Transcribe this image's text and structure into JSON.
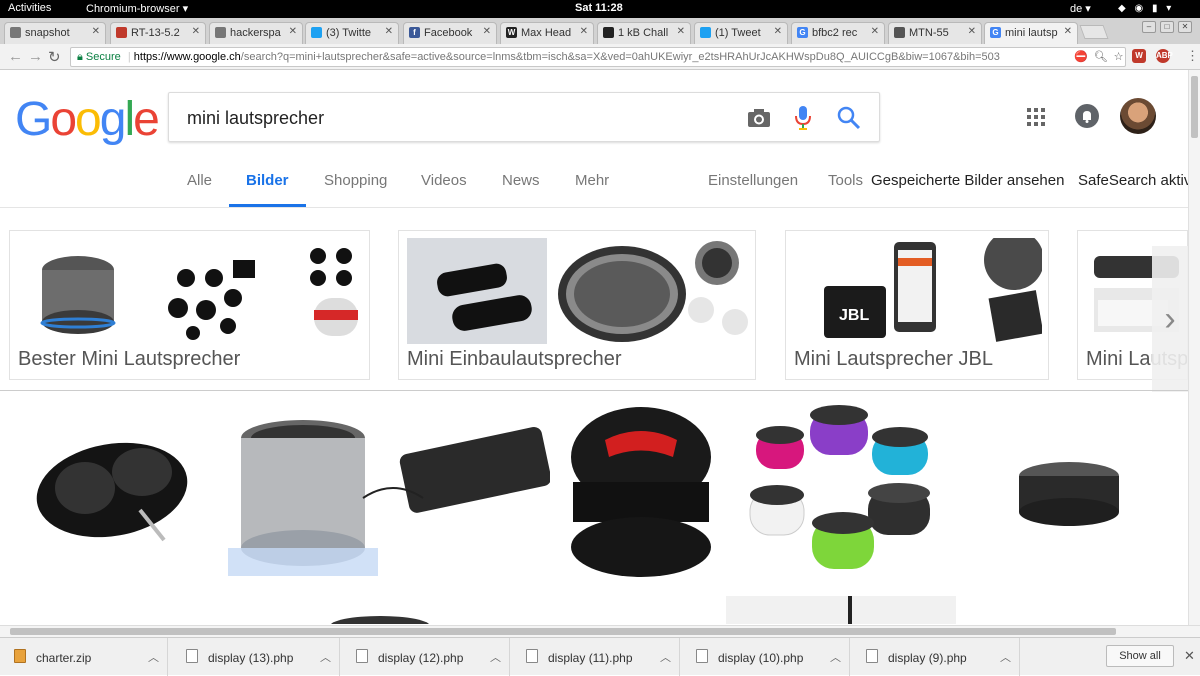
{
  "system_bar": {
    "activities": "Activities",
    "app": "Chromium-browser ▾",
    "clock": "Sat 11:28",
    "lang": "de ▾"
  },
  "tabs": [
    {
      "label": "snapshot",
      "fav_color": "#777",
      "fav": ""
    },
    {
      "label": "RT-13-5.2",
      "fav_color": "#c0392b",
      "fav": ""
    },
    {
      "label": "hackerspa",
      "fav_color": "#777",
      "fav": ""
    },
    {
      "label": "(3) Twitte",
      "fav_color": "#1da1f2",
      "fav": ""
    },
    {
      "label": "Facebook",
      "fav_color": "#3b5998",
      "fav": "f"
    },
    {
      "label": "Max Head",
      "fav_color": "#222",
      "fav": "W"
    },
    {
      "label": "1 kB Chall",
      "fav_color": "#222",
      "fav": ""
    },
    {
      "label": "(1) Tweet",
      "fav_color": "#1da1f2",
      "fav": ""
    },
    {
      "label": "bfbc2 rec",
      "fav_color": "#4285f4",
      "fav": "G"
    },
    {
      "label": "MTN-55",
      "fav_color": "#555",
      "fav": ""
    },
    {
      "label": "mini lautsp",
      "fav_color": "#4285f4",
      "fav": "G"
    }
  ],
  "omnibox": {
    "secure_label": "Secure",
    "host": "https://www.google.ch",
    "path": "/search?q=mini+lautsprecher&safe=active&source=lnms&tbm=isch&sa=X&ved=0ahUKEwiyr_e2tsHRAhUrJcAKHWspDu8Q_AUICCgB&biw=1067&bih=503"
  },
  "google": {
    "logo": [
      "G",
      "o",
      "o",
      "g",
      "l",
      "e"
    ],
    "logo_colors": [
      "#4285f4",
      "#ea4335",
      "#fbbc05",
      "#4285f4",
      "#34a853",
      "#ea4335"
    ],
    "query": "mini lautsprecher",
    "tabs": [
      "Alle",
      "Bilder",
      "Shopping",
      "Videos",
      "News",
      "Mehr"
    ],
    "active_tab": "Bilder",
    "right_tools": [
      "Einstellungen",
      "Tools",
      "Gespeicherte Bilder ansehen",
      "SafeSearch aktiv"
    ]
  },
  "related": [
    {
      "label": "Bester Mini Lautsprecher"
    },
    {
      "label": "Mini Einbaulautsprecher"
    },
    {
      "label": "Mini Lautsprecher JBL"
    },
    {
      "label": "Mini Lautsprecher"
    }
  ],
  "downloads": [
    {
      "name": "charter.zip",
      "type": "zip"
    },
    {
      "name": "display (13).php",
      "type": "php"
    },
    {
      "name": "display (12).php",
      "type": "php"
    },
    {
      "name": "display (11).php",
      "type": "php"
    },
    {
      "name": "display (10).php",
      "type": "php"
    },
    {
      "name": "display (9).php",
      "type": "php"
    }
  ],
  "show_all": "Show all"
}
